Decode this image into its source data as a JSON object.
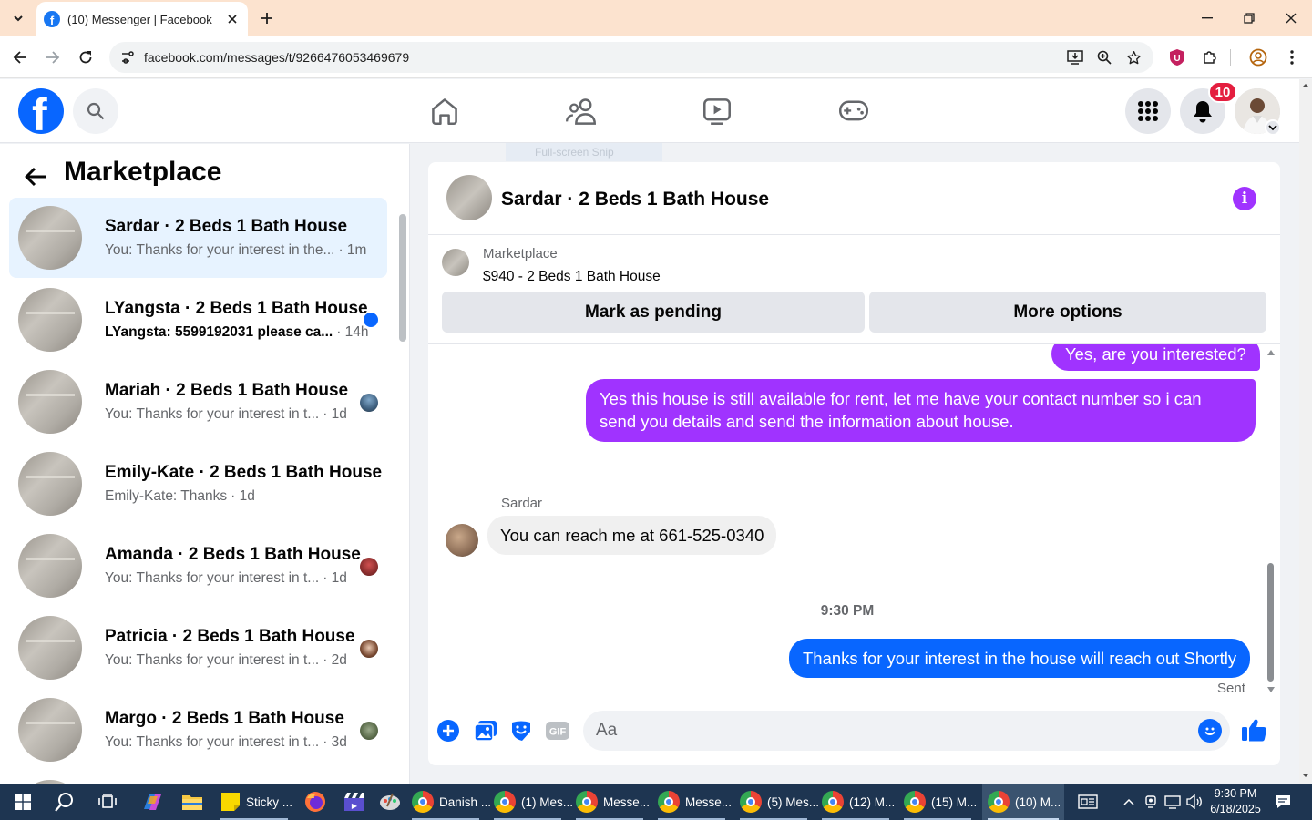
{
  "browser": {
    "tab_title": "(10) Messenger | Facebook",
    "favicon_letter": "f",
    "url": "facebook.com/messages/t/9266476053469679"
  },
  "fb_header": {
    "logo_letter": "f",
    "notification_count": "10",
    "accent": "#0866ff"
  },
  "left": {
    "title": "Marketplace",
    "conversations": [
      {
        "name": "Sardar · 2 Beds 1 Bath House",
        "preview": "You: Thanks for your interest in the...",
        "time": "· 1m",
        "active": true
      },
      {
        "name": "LYangsta · 2 Beds 1 Bath House",
        "preview": "LYangsta: 5599192031 please ca...",
        "time": "· 14h",
        "unread": true
      },
      {
        "name": "Mariah · 2 Beds 1 Bath House",
        "preview": "You: Thanks for your interest in t...",
        "time": "· 1d"
      },
      {
        "name": "Emily-Kate · 2 Beds 1 Bath House",
        "preview": "Emily-Kate: Thanks",
        "time": "· 1d"
      },
      {
        "name": "Amanda · 2 Beds 1 Bath House",
        "preview": "You: Thanks for your interest in t...",
        "time": "· 1d"
      },
      {
        "name": "Patricia · 2 Beds 1 Bath House",
        "preview": "You: Thanks for your interest in t...",
        "time": "· 2d"
      },
      {
        "name": "Margo · 2 Beds 1 Bath House",
        "preview": "You: Thanks for your interest in t...",
        "time": "· 3d"
      }
    ]
  },
  "snip_label": "Full-screen Snip",
  "chat": {
    "title": "Sardar · 2 Beds 1 Bath House",
    "listing_label": "Marketplace",
    "listing_price": "$940 - 2 Beds 1 Bath House",
    "mark_pending": "Mark as pending",
    "more_options": "More options",
    "messages": {
      "m1": "Yes, are you interested?",
      "m2": "Yes this house is still available for rent, let me have your contact number so i can send you details and send the information about house.",
      "sender": "Sardar",
      "m3": "You can reach me at 661-525-0340",
      "time": "9:30 PM",
      "m4": "Thanks for your interest in the house will reach out Shortly",
      "status": "Sent"
    },
    "composer_placeholder": "Aa",
    "gif_label": "GIF",
    "sent_color": "#a033ff"
  },
  "taskbar": {
    "sticky": "Sticky ...",
    "apps": [
      {
        "label": "Danish ...",
        "active": false
      },
      {
        "label": "(1) Mes...",
        "active": false
      },
      {
        "label": "Messe...",
        "active": false
      },
      {
        "label": "Messe...",
        "active": false
      },
      {
        "label": "(5) Mes...",
        "active": false
      },
      {
        "label": "(12) M...",
        "active": false
      },
      {
        "label": "(15) M...",
        "active": false
      },
      {
        "label": "(10) M...",
        "active": true
      }
    ],
    "time": "9:30 PM",
    "date": "6/18/2025"
  }
}
